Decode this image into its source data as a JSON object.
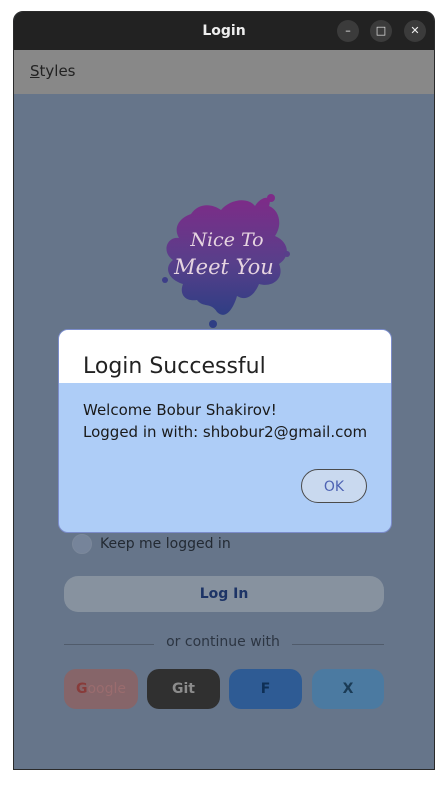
{
  "window": {
    "title": "Login"
  },
  "menu": {
    "styles_prefix": "S",
    "styles_rest": "tyles"
  },
  "form": {
    "keep_logged_in": "Keep me logged in",
    "login_button": "Log In",
    "continue_with": "or continue with"
  },
  "social": {
    "google_g": "G",
    "google_rest": "oogle",
    "git": "Git",
    "f": "F",
    "x": "X"
  },
  "dialog": {
    "title": "Login Successful",
    "line1": "Welcome Bobur Shakirov!",
    "line2": "Logged in with: shbobur2@gmail.com",
    "ok": "OK"
  },
  "logo": {
    "text_line1": "Nice To",
    "text_line2": "Meet You"
  },
  "colors": {
    "dialog_body": "#aecdf7",
    "backdrop": "#66758a",
    "accent": "#4e63b3"
  }
}
